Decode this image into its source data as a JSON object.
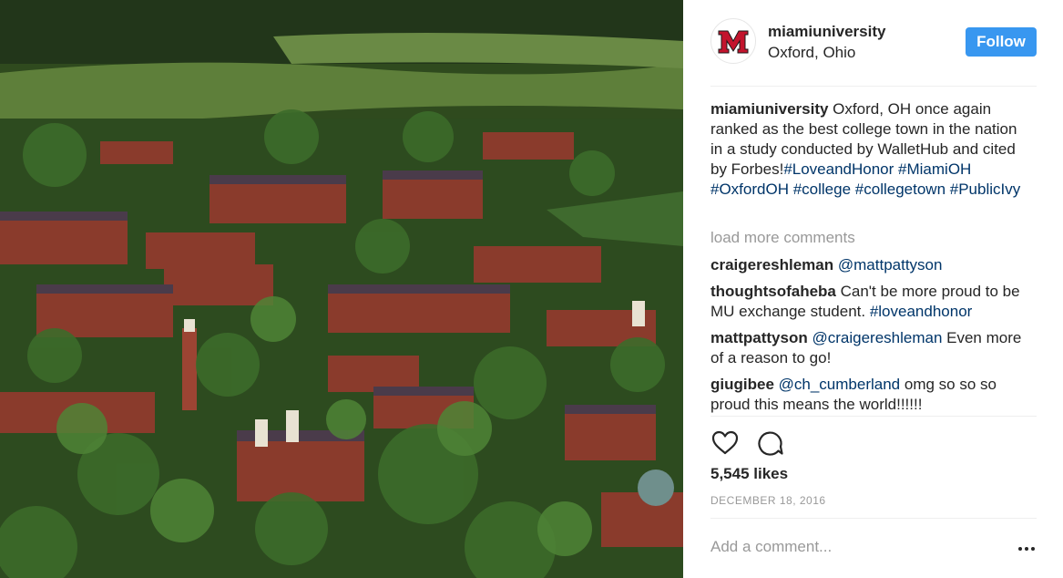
{
  "post": {
    "username": "miamiuniversity",
    "location": "Oxford, Ohio",
    "follow_label": "Follow",
    "caption_text": " Oxford, OH once again ranked as the best college town in the nation in a study conducted by WalletHub and cited by Forbes!",
    "hashtags": [
      "#LoveandHonor",
      "#MiamiOH",
      "#OxfordOH",
      "#college",
      "#collegetown",
      "#PublicIvy"
    ],
    "load_more": "load more comments",
    "comments": [
      {
        "user": "craigereshleman",
        "mention": "@mattpattyson",
        "text": ""
      },
      {
        "user": "thoughtsofaheba",
        "mention": "",
        "text": " Can't be more proud to be MU exchange student. ",
        "tag": "#loveandhonor"
      },
      {
        "user": "mattpattyson",
        "mention": "@craigereshleman",
        "text": " Even more of a reason to go!"
      },
      {
        "user": "giugibee",
        "mention": "@ch_cumberland",
        "text": " omg so so so proud this means the world!!!!!!"
      }
    ],
    "likes": "5,545 likes",
    "date": "DECEMBER 18, 2016",
    "add_comment_placeholder": "Add a comment..."
  },
  "icons": {
    "like": "heart-icon",
    "comment": "comment-icon",
    "more": "more-options-icon"
  },
  "colors": {
    "follow_button": "#3897f0",
    "link": "#003569",
    "muted": "#999999",
    "brand_red": "#c3142d"
  }
}
